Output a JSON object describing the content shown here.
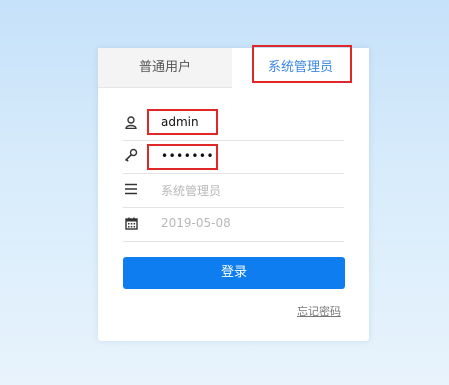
{
  "tabs": {
    "normal_user": "普通用户",
    "system_admin": "系统管理员"
  },
  "form": {
    "username": "admin",
    "password": "•••••••",
    "role_placeholder": "系统管理员",
    "date_placeholder": "2019-05-08",
    "login_button": "登录",
    "forgot_password": "忘记密码"
  },
  "colors": {
    "accent": "#0e7df0",
    "tab_active_text": "#3a87e6",
    "highlight_box": "#e02828"
  },
  "icons": [
    "user-icon",
    "key-icon",
    "menu-icon",
    "calendar-icon"
  ]
}
